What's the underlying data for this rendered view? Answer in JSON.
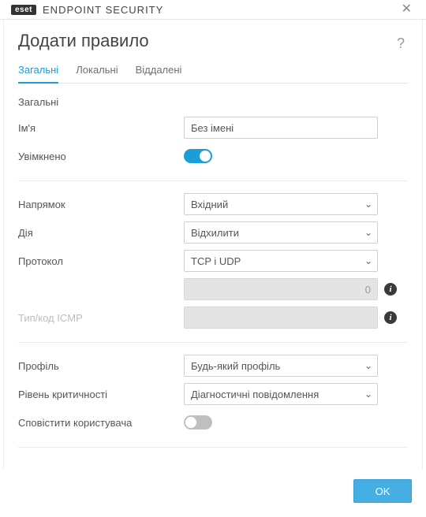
{
  "titlebar": {
    "brand_badge": "eset",
    "brand_text": "ENDPOINT SECURITY"
  },
  "page": {
    "title": "Додати правило",
    "help_glyph": "?"
  },
  "tabs": [
    {
      "label": "Загальні",
      "active": true
    },
    {
      "label": "Локальні",
      "active": false
    },
    {
      "label": "Віддалені",
      "active": false
    }
  ],
  "general": {
    "section_title": "Загальні",
    "name_label": "Ім'я",
    "name_value": "Без імені",
    "enabled_label": "Увімкнено",
    "enabled": true
  },
  "routing": {
    "direction_label": "Напрямок",
    "direction_value": "Вхідний",
    "action_label": "Дія",
    "action_value": "Відхилити",
    "protocol_label": "Протокол",
    "protocol_value": "TCP і UDP",
    "port_value": "0",
    "icmp_label": "Тип/код ICMP",
    "icmp_value": ""
  },
  "profile": {
    "profile_label": "Профіль",
    "profile_value": "Будь-який профіль",
    "severity_label": "Рівень критичності",
    "severity_value": "Діагностичні повідомлення",
    "notify_label": "Сповістити користувача",
    "notify": false
  },
  "footer": {
    "ok_label": "OK"
  },
  "icons": {
    "close": "✕",
    "info": "i",
    "chevron_down": "⌄"
  }
}
